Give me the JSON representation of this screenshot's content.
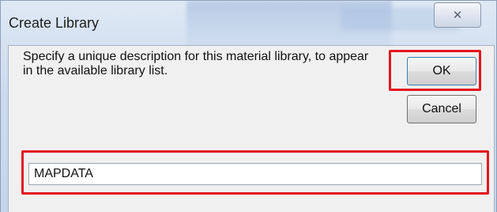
{
  "dialog": {
    "title": "Create Library",
    "close_icon": "close-icon",
    "close_glyph": "✕",
    "description": "Specify a unique description for this material library, to appear in the available library list.",
    "ok_label": "OK",
    "cancel_label": "Cancel",
    "name_value": "MAPDATA"
  },
  "colors": {
    "highlight": "#e3161f",
    "titlebar": "#cddbee",
    "client": "#f0f0f0"
  }
}
